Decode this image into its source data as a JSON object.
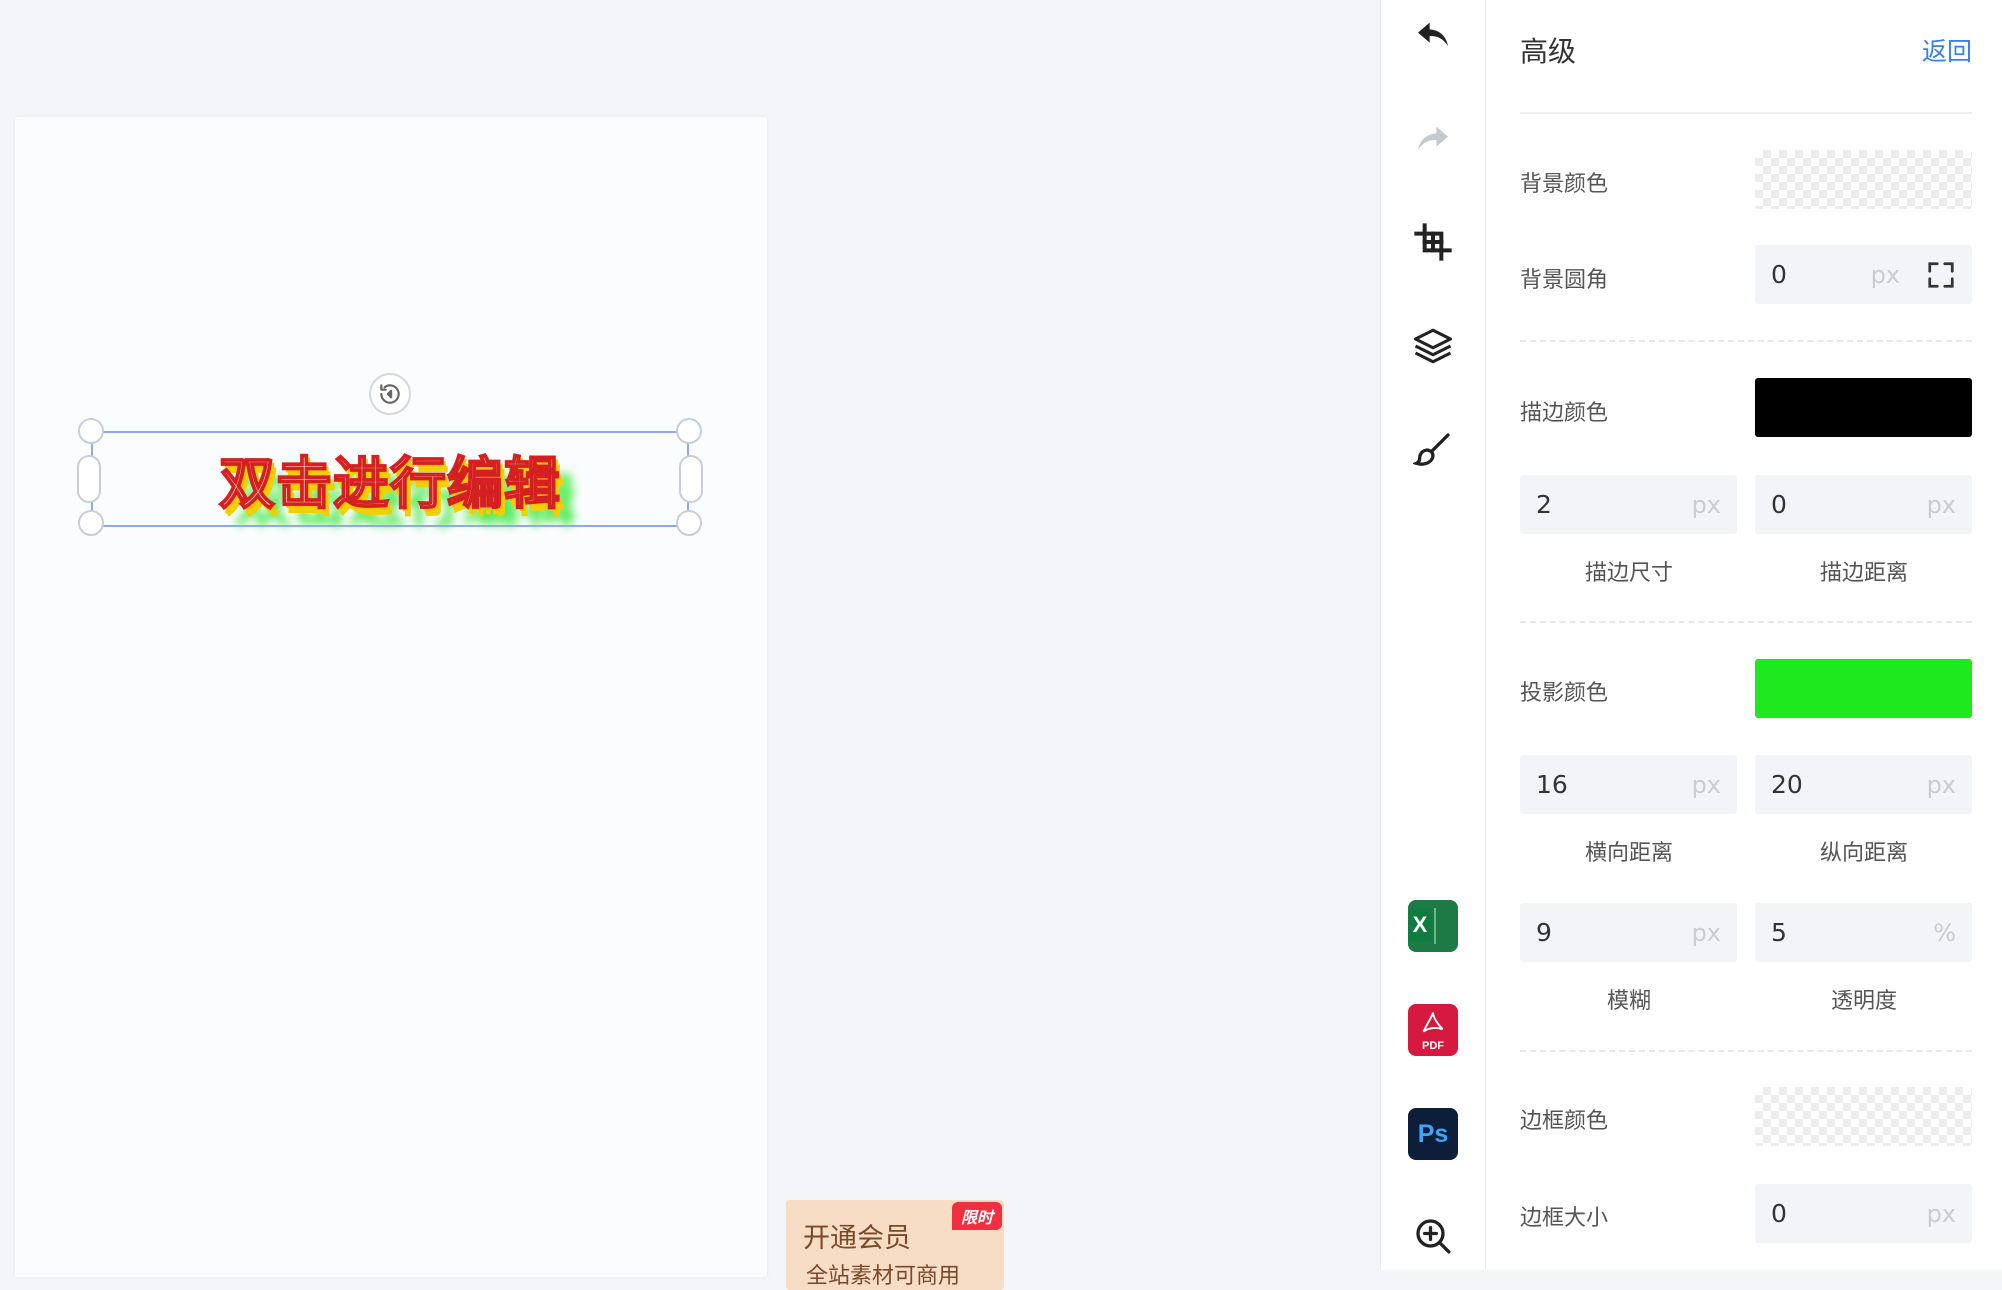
{
  "canvas": {
    "text": "双击进行编辑"
  },
  "promo": {
    "title": "开通会员",
    "subtitle": "全站素材可商用",
    "badge": "限时"
  },
  "toolbar": {
    "items": [
      "undo-icon",
      "redo-icon",
      "crop-icon",
      "layers-icon",
      "brush-icon",
      "excel-icon",
      "pdf-icon",
      "photoshop-icon",
      "zoom-in-icon"
    ],
    "pdf_label": "PDF",
    "ps_label": "Ps",
    "excel_label": "X"
  },
  "panel": {
    "title": "高级",
    "back": "返回",
    "bg_color": {
      "label": "背景颜色",
      "value": "transparent"
    },
    "bg_radius": {
      "label": "背景圆角",
      "value": "0",
      "unit": "px"
    },
    "stroke_color": {
      "label": "描边颜色",
      "value": "#000000"
    },
    "stroke_size": {
      "label": "描边尺寸",
      "value": "2",
      "unit": "px"
    },
    "stroke_distance": {
      "label": "描边距离",
      "value": "0",
      "unit": "px"
    },
    "shadow_color": {
      "label": "投影颜色",
      "value": "#1ee81e"
    },
    "shadow_x": {
      "label": "横向距离",
      "value": "16",
      "unit": "px"
    },
    "shadow_y": {
      "label": "纵向距离",
      "value": "20",
      "unit": "px"
    },
    "shadow_blur": {
      "label": "模糊",
      "value": "9",
      "unit": "px"
    },
    "shadow_opacity": {
      "label": "透明度",
      "value": "5",
      "unit": "%"
    },
    "border_color": {
      "label": "边框颜色",
      "value": "transparent"
    },
    "border_size": {
      "label": "边框大小",
      "value": "0",
      "unit": "px"
    }
  },
  "colors": {
    "accent": "#3a7ff0",
    "selection": "#8aaaf0",
    "stroke": "#000000",
    "shadow": "#1ee81e"
  }
}
